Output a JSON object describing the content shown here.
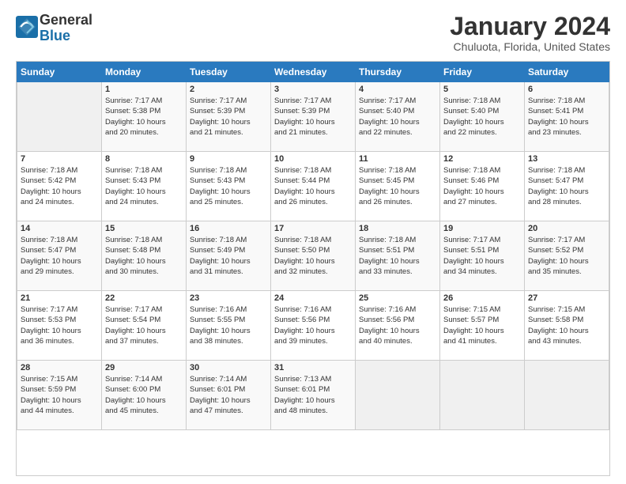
{
  "header": {
    "logo_line1": "General",
    "logo_line2": "Blue",
    "title": "January 2024",
    "subtitle": "Chuluota, Florida, United States"
  },
  "calendar": {
    "days_of_week": [
      "Sunday",
      "Monday",
      "Tuesday",
      "Wednesday",
      "Thursday",
      "Friday",
      "Saturday"
    ],
    "weeks": [
      [
        {
          "day": "",
          "content": ""
        },
        {
          "day": "1",
          "content": "Sunrise: 7:17 AM\nSunset: 5:38 PM\nDaylight: 10 hours\nand 20 minutes."
        },
        {
          "day": "2",
          "content": "Sunrise: 7:17 AM\nSunset: 5:39 PM\nDaylight: 10 hours\nand 21 minutes."
        },
        {
          "day": "3",
          "content": "Sunrise: 7:17 AM\nSunset: 5:39 PM\nDaylight: 10 hours\nand 21 minutes."
        },
        {
          "day": "4",
          "content": "Sunrise: 7:17 AM\nSunset: 5:40 PM\nDaylight: 10 hours\nand 22 minutes."
        },
        {
          "day": "5",
          "content": "Sunrise: 7:18 AM\nSunset: 5:40 PM\nDaylight: 10 hours\nand 22 minutes."
        },
        {
          "day": "6",
          "content": "Sunrise: 7:18 AM\nSunset: 5:41 PM\nDaylight: 10 hours\nand 23 minutes."
        }
      ],
      [
        {
          "day": "7",
          "content": "Sunrise: 7:18 AM\nSunset: 5:42 PM\nDaylight: 10 hours\nand 24 minutes."
        },
        {
          "day": "8",
          "content": "Sunrise: 7:18 AM\nSunset: 5:43 PM\nDaylight: 10 hours\nand 24 minutes."
        },
        {
          "day": "9",
          "content": "Sunrise: 7:18 AM\nSunset: 5:43 PM\nDaylight: 10 hours\nand 25 minutes."
        },
        {
          "day": "10",
          "content": "Sunrise: 7:18 AM\nSunset: 5:44 PM\nDaylight: 10 hours\nand 26 minutes."
        },
        {
          "day": "11",
          "content": "Sunrise: 7:18 AM\nSunset: 5:45 PM\nDaylight: 10 hours\nand 26 minutes."
        },
        {
          "day": "12",
          "content": "Sunrise: 7:18 AM\nSunset: 5:46 PM\nDaylight: 10 hours\nand 27 minutes."
        },
        {
          "day": "13",
          "content": "Sunrise: 7:18 AM\nSunset: 5:47 PM\nDaylight: 10 hours\nand 28 minutes."
        }
      ],
      [
        {
          "day": "14",
          "content": "Sunrise: 7:18 AM\nSunset: 5:47 PM\nDaylight: 10 hours\nand 29 minutes."
        },
        {
          "day": "15",
          "content": "Sunrise: 7:18 AM\nSunset: 5:48 PM\nDaylight: 10 hours\nand 30 minutes."
        },
        {
          "day": "16",
          "content": "Sunrise: 7:18 AM\nSunset: 5:49 PM\nDaylight: 10 hours\nand 31 minutes."
        },
        {
          "day": "17",
          "content": "Sunrise: 7:18 AM\nSunset: 5:50 PM\nDaylight: 10 hours\nand 32 minutes."
        },
        {
          "day": "18",
          "content": "Sunrise: 7:18 AM\nSunset: 5:51 PM\nDaylight: 10 hours\nand 33 minutes."
        },
        {
          "day": "19",
          "content": "Sunrise: 7:17 AM\nSunset: 5:51 PM\nDaylight: 10 hours\nand 34 minutes."
        },
        {
          "day": "20",
          "content": "Sunrise: 7:17 AM\nSunset: 5:52 PM\nDaylight: 10 hours\nand 35 minutes."
        }
      ],
      [
        {
          "day": "21",
          "content": "Sunrise: 7:17 AM\nSunset: 5:53 PM\nDaylight: 10 hours\nand 36 minutes."
        },
        {
          "day": "22",
          "content": "Sunrise: 7:17 AM\nSunset: 5:54 PM\nDaylight: 10 hours\nand 37 minutes."
        },
        {
          "day": "23",
          "content": "Sunrise: 7:16 AM\nSunset: 5:55 PM\nDaylight: 10 hours\nand 38 minutes."
        },
        {
          "day": "24",
          "content": "Sunrise: 7:16 AM\nSunset: 5:56 PM\nDaylight: 10 hours\nand 39 minutes."
        },
        {
          "day": "25",
          "content": "Sunrise: 7:16 AM\nSunset: 5:56 PM\nDaylight: 10 hours\nand 40 minutes."
        },
        {
          "day": "26",
          "content": "Sunrise: 7:15 AM\nSunset: 5:57 PM\nDaylight: 10 hours\nand 41 minutes."
        },
        {
          "day": "27",
          "content": "Sunrise: 7:15 AM\nSunset: 5:58 PM\nDaylight: 10 hours\nand 43 minutes."
        }
      ],
      [
        {
          "day": "28",
          "content": "Sunrise: 7:15 AM\nSunset: 5:59 PM\nDaylight: 10 hours\nand 44 minutes."
        },
        {
          "day": "29",
          "content": "Sunrise: 7:14 AM\nSunset: 6:00 PM\nDaylight: 10 hours\nand 45 minutes."
        },
        {
          "day": "30",
          "content": "Sunrise: 7:14 AM\nSunset: 6:01 PM\nDaylight: 10 hours\nand 47 minutes."
        },
        {
          "day": "31",
          "content": "Sunrise: 7:13 AM\nSunset: 6:01 PM\nDaylight: 10 hours\nand 48 minutes."
        },
        {
          "day": "",
          "content": ""
        },
        {
          "day": "",
          "content": ""
        },
        {
          "day": "",
          "content": ""
        }
      ]
    ]
  }
}
